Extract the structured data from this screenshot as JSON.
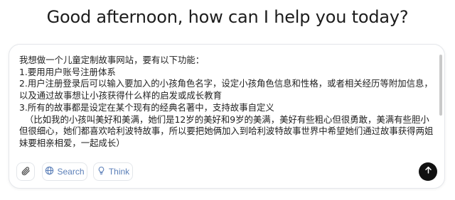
{
  "header": {
    "greeting": "Good afternoon, how can I help you today?"
  },
  "composer": {
    "text": "我想做一个儿童定制故事网站，要有以下功能：\n1.要用用户账号注册体系\n2.用户注册登录后可以输入要加入的小孩角色名字，设定小孩角色信息和性格，或者相关经历等附加信息，以及通过故事想让小孩获得什么样的启发或成长教育\n3.所有的故事都是设定在某个现有的经典名著中，支持故事自定义\n  （比如我的小孩叫美好和美满，她们是12岁的美好和9岁的美满，美好有些粗心但很勇敢，美满有些胆小但很细心，她们都喜欢哈利波特故事，所以要把她俩加入到哈利波特故事世界中希望她们通过故事获得两姐妹要相亲相爱，一起成长）"
  },
  "toolbar": {
    "attach_icon": "paperclip-icon",
    "search_label": "Search",
    "search_icon": "globe-icon",
    "think_label": "Think",
    "think_icon": "sparkle-bulb-icon",
    "send_icon": "arrow-up-icon"
  },
  "colors": {
    "accent": "#5b7fb8",
    "send_bg": "#111111",
    "border": "#e5e7eb"
  }
}
